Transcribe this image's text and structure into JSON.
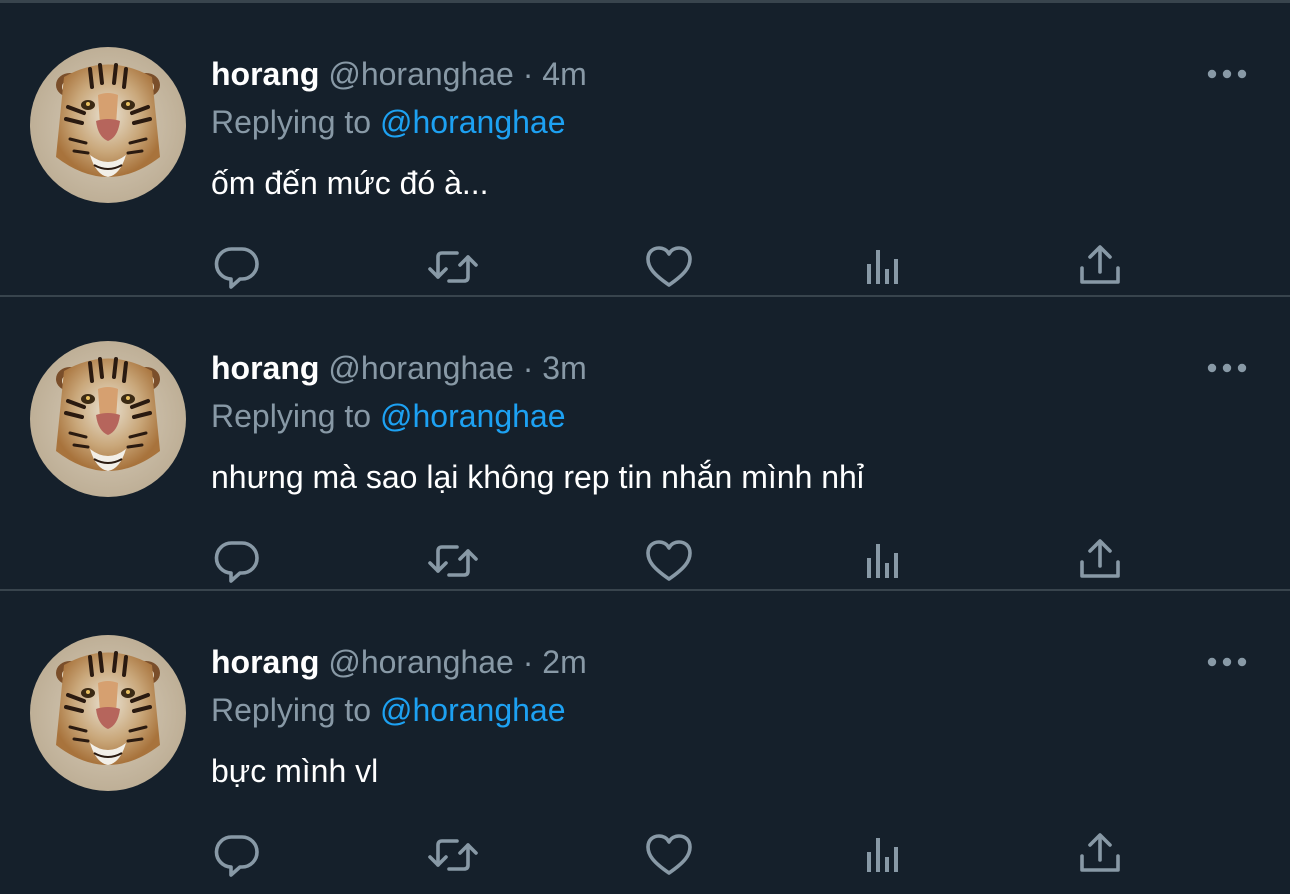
{
  "colors": {
    "background": "#15202b",
    "divider": "#38444d",
    "primary_text": "#ffffff",
    "secondary_text": "#8899a6",
    "accent": "#1da1f2"
  },
  "icons": {
    "more": "more-horizontal-icon",
    "reply": "reply-bubble-icon",
    "retweet": "retweet-icon",
    "like": "heart-icon",
    "analytics": "bar-chart-icon",
    "share": "share-upload-icon",
    "avatar": "tiger-avatar"
  },
  "tweets": [
    {
      "name": "horang",
      "handle": "@horanghae",
      "separator": "·",
      "time": "4m",
      "replying_prefix": "Replying to",
      "replying_to": "@horanghae",
      "text": "ốm đến mức đó à..."
    },
    {
      "name": "horang",
      "handle": "@horanghae",
      "separator": "·",
      "time": "3m",
      "replying_prefix": "Replying to",
      "replying_to": "@horanghae",
      "text": "nhưng mà sao lại không rep tin nhắn mình nhỉ"
    },
    {
      "name": "horang",
      "handle": "@horanghae",
      "separator": "·",
      "time": "2m",
      "replying_prefix": "Replying to",
      "replying_to": "@horanghae",
      "text": "bực mình vl"
    }
  ]
}
